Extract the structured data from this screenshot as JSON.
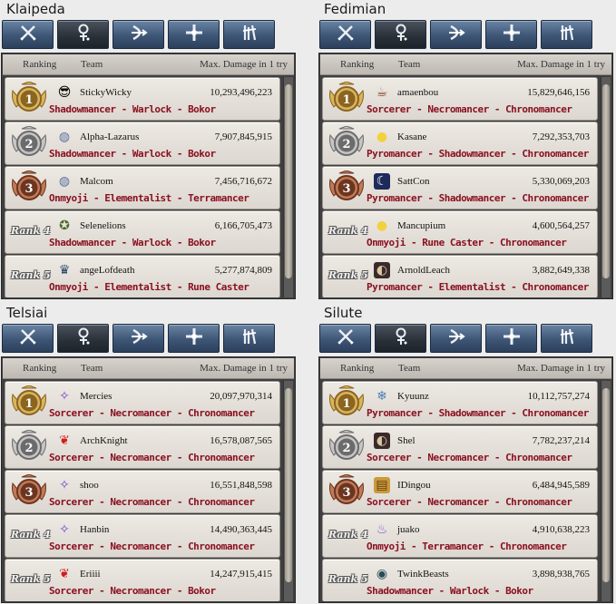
{
  "headers": {
    "ranking": "Ranking",
    "team": "Team",
    "damage": "Max. Damage in 1 try"
  },
  "tabs": [
    {
      "icon": "swords-icon"
    },
    {
      "icon": "wizard-icon"
    },
    {
      "icon": "bow-icon"
    },
    {
      "icon": "cross-icon"
    },
    {
      "icon": "scout-icon"
    }
  ],
  "colors": {
    "tab_blue": "#3e5676",
    "class_text": "#8b1020",
    "gold": "#c8a14a",
    "silver": "#a9a9a9",
    "bronze": "#a0583a"
  },
  "servers": [
    {
      "name": "Klaipeda",
      "entries": [
        {
          "rank": "1",
          "player": "StickyWicky",
          "damage": "10,293,496,223",
          "classes": "Shadowmancer - Warlock - Bokor",
          "avatar": "sunglasses-icon"
        },
        {
          "rank": "2",
          "player": "Alpha-Lazarus",
          "damage": "7,907,845,915",
          "classes": "Shadowmancer - Warlock - Bokor",
          "avatar": "globe-icon"
        },
        {
          "rank": "3",
          "player": "Malcom",
          "damage": "7,456,716,672",
          "classes": "Onmyoji - Elementalist - Terramancer",
          "avatar": "globe-icon"
        },
        {
          "rank": "Rank 4",
          "player": "Selenelions",
          "damage": "6,166,705,473",
          "classes": "Shadowmancer - Warlock - Bokor",
          "avatar": "emblem-icon"
        },
        {
          "rank": "Rank 5",
          "player": "angeLofdeath",
          "damage": "5,277,874,809",
          "classes": "Onmyoji - Elementalist - Rune Caster",
          "avatar": "trophy-icon"
        }
      ]
    },
    {
      "name": "Fedimian",
      "entries": [
        {
          "rank": "1",
          "player": "amaenbou",
          "damage": "15,829,646,156",
          "classes": "Sorcerer - Necromancer - Chronomancer",
          "avatar": "cup-icon"
        },
        {
          "rank": "2",
          "player": "Kasane",
          "damage": "7,292,353,703",
          "classes": "Pyromancer - Shadowmancer - Chronomancer",
          "avatar": "chick-icon"
        },
        {
          "rank": "3",
          "player": "SattCon",
          "damage": "5,330,069,203",
          "classes": "Pyromancer - Shadowmancer - Chronomancer",
          "avatar": "moon-icon"
        },
        {
          "rank": "Rank 4",
          "player": "Mancupium",
          "damage": "4,600,564,257",
          "classes": "Onmyoji - Rune Caster - Chronomancer",
          "avatar": "chick-icon"
        },
        {
          "rank": "Rank 5",
          "player": "ArnoldLeach",
          "damage": "3,882,649,338",
          "classes": "Pyromancer - Elementalist - Chronomancer",
          "avatar": "portrait-icon"
        }
      ]
    },
    {
      "name": "Telsiai",
      "entries": [
        {
          "rank": "1",
          "player": "Mercies",
          "damage": "20,097,970,314",
          "classes": "Sorcerer - Necromancer - Chronomancer",
          "avatar": "sprite-icon"
        },
        {
          "rank": "2",
          "player": "ArchKnight",
          "damage": "16,578,087,565",
          "classes": "Sorcerer - Necromancer - Chronomancer",
          "avatar": "phoenix-icon"
        },
        {
          "rank": "3",
          "player": "shoo",
          "damage": "16,551,848,598",
          "classes": "Sorcerer - Necromancer - Chronomancer",
          "avatar": "sprite-icon"
        },
        {
          "rank": "Rank 4",
          "player": "Hanbin",
          "damage": "14,490,363,445",
          "classes": "Sorcerer - Necromancer - Chronomancer",
          "avatar": "sprite-icon"
        },
        {
          "rank": "Rank 5",
          "player": "Eriiii",
          "damage": "14,247,915,415",
          "classes": "Sorcerer - Necromancer - Bokor",
          "avatar": "phoenix-icon"
        }
      ]
    },
    {
      "name": "Silute",
      "entries": [
        {
          "rank": "1",
          "player": "Kyuunz",
          "damage": "10,112,757,274",
          "classes": "Pyromancer - Shadowmancer - Chronomancer",
          "avatar": "snowflake-icon"
        },
        {
          "rank": "2",
          "player": "Shel",
          "damage": "7,782,237,214",
          "classes": "Sorcerer - Necromancer - Chronomancer",
          "avatar": "portrait-icon"
        },
        {
          "rank": "3",
          "player": "IDingou",
          "damage": "6,484,945,589",
          "classes": "Sorcerer - Necromancer - Chronomancer",
          "avatar": "scroll-icon"
        },
        {
          "rank": "Rank 4",
          "player": "juako",
          "damage": "4,910,638,223",
          "classes": "Onmyoji - Terramancer - Chronomancer",
          "avatar": "flame-icon"
        },
        {
          "rank": "Rank 5",
          "player": "TwinkBeasts",
          "damage": "3,898,938,765",
          "classes": "Shadowmancer - Warlock - Bokor",
          "avatar": "beast-icon"
        }
      ]
    }
  ]
}
